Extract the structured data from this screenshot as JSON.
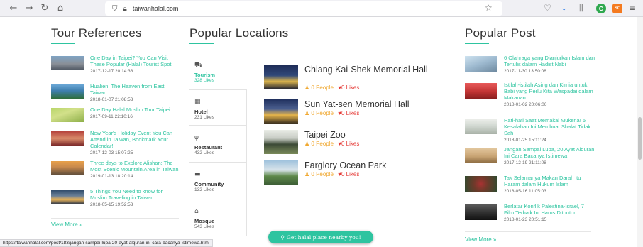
{
  "browser": {
    "url": "taiwanhalal.com",
    "status_url": "https://taiwanhalal.com/post/183/jangan-sampai-lupa-20-ayat-alquran-ini-cara-bacanya-istimewa.html",
    "profile_initial": "G",
    "extension_label": "SC"
  },
  "tour": {
    "title": "Tour References",
    "items": [
      {
        "title": "One Day in Taipei? You Can Visit These Popular (Halal) Tourist Spot",
        "date": "2017-12-17 20:14:38"
      },
      {
        "title": "Hualien, The Heaven from East Taiwan",
        "date": "2018-01-07 21:08:53"
      },
      {
        "title": "One Day Halal Muslim Tour Taipei",
        "date": "2017-09-11 22:10:16"
      },
      {
        "title": "New Year's Holiday Event You Can Attend in Taiwan, Bookmark Your Calendar!",
        "date": "2017-12-03 15:07:25"
      },
      {
        "title": "Three days to Explore Alishan: The Most Scenic Mountain Area in Taiwan",
        "date": "2019-01-13 18:20:14"
      },
      {
        "title": "5 Things You Need to know for Muslim Traveling in Taiwan",
        "date": "2018-05-15 19:52:53"
      }
    ],
    "view_more": "View More »"
  },
  "locations": {
    "title": "Popular Locations",
    "categories": [
      {
        "name": "Tourism",
        "likes": "328 Likes",
        "icon": "car-icon"
      },
      {
        "name": "Hotel",
        "likes": "231 Likes",
        "icon": "hotel-icon"
      },
      {
        "name": "Restaurant",
        "likes": "432 Likes",
        "icon": "utensils-icon"
      },
      {
        "name": "Community",
        "likes": "132 Likes",
        "icon": "community-icon"
      },
      {
        "name": "Mosque",
        "likes": "543 Likes",
        "icon": "mosque-icon"
      }
    ],
    "places": [
      {
        "name": "Chiang Kai-Shek Memorial Hall",
        "people": "0 People",
        "likes": "0 Likes"
      },
      {
        "name": "Sun Yat-sen Memorial Hall",
        "people": "0 People",
        "likes": "0 Likes"
      },
      {
        "name": "Taipei Zoo",
        "people": "0 People",
        "likes": "0 Likes"
      },
      {
        "name": "Farglory Ocean Park",
        "people": "0 People",
        "likes": "0 Likes"
      }
    ],
    "halal_button": "Get halal place nearby you!"
  },
  "posts": {
    "title": "Popular Post",
    "items": [
      {
        "title": "6 Olahraga yang Dianjurkan Islam dan Tertulis dalam Hadist Nabi",
        "date": "2017-11-30 13:50:08"
      },
      {
        "title": "Istilah-istilah Asing dan Kimia untuk Babi yang Perlu Kita Waspadai dalam Makanan",
        "date": "2018-01-02 20:06:06"
      },
      {
        "title": "Hati-hati Saat Memakai Mukena! 5 Kesalahan Ini Membuat Shalat Tidak Sah",
        "date": "2018-01-25 15:11:24"
      },
      {
        "title": "Jangan Sampai Lupa, 20 Ayat Alquran Ini Cara Bacanya Istimewa",
        "date": "2017-12-19 21:11:08"
      },
      {
        "title": "Tak Selamanya Makan Darah itu Haram dalam Hukum Islam",
        "date": "2018-05-16 11:05:03"
      },
      {
        "title": "Berlatar Konflik Palestina-Israel, 7 Film Terbaik Ini Harus Ditonton",
        "date": "2018-01-23 20:51:15"
      }
    ],
    "view_more": "View More »"
  },
  "colors": {
    "accent": "#2ec4a0",
    "people": "#f0a830",
    "likes": "#e53935"
  }
}
